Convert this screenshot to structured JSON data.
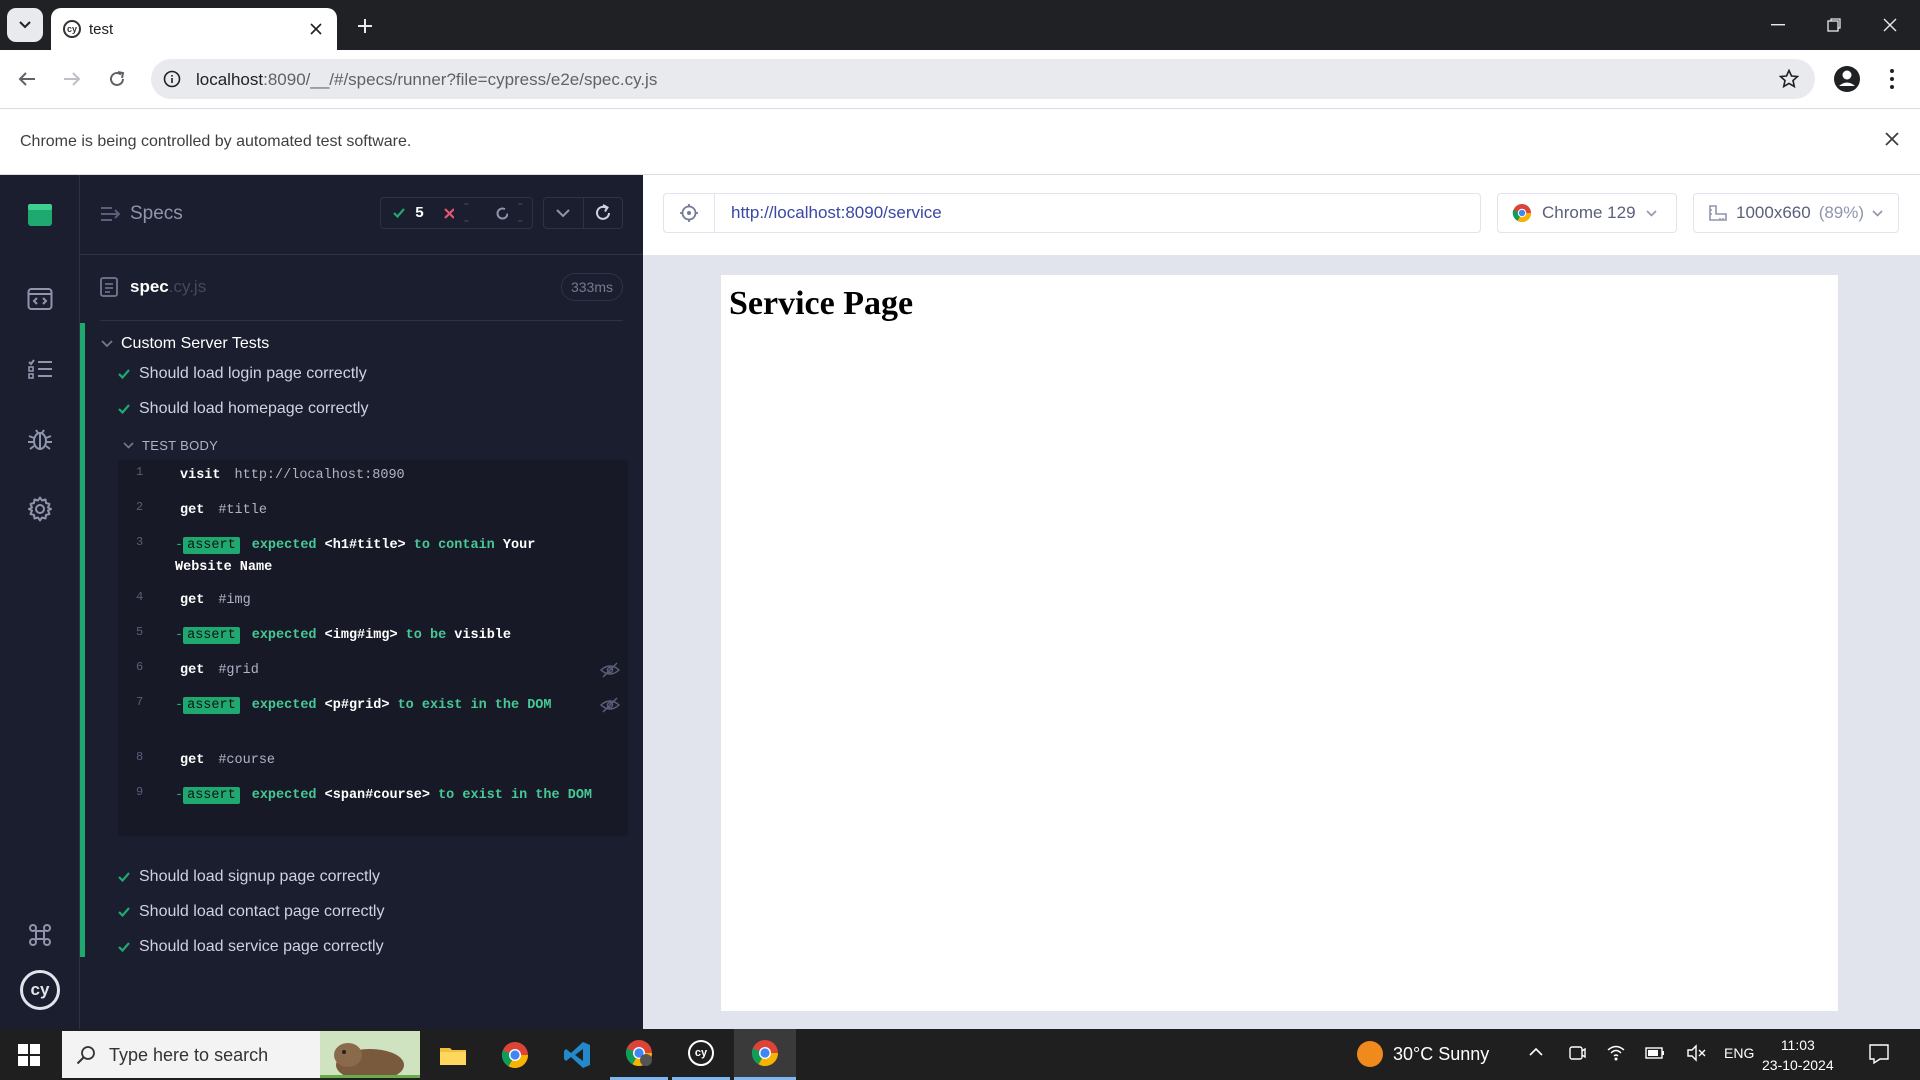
{
  "browser": {
    "tab_title": "test",
    "url_host": "localhost",
    "url_rest": ":8090/__/#/specs/runner?file=cypress/e2e/spec.cy.js",
    "infobar_text": "Chrome is being controlled by automated test software."
  },
  "reporter": {
    "specs_label": "Specs",
    "passed_count": "5",
    "failed_count": "--",
    "pending_count": "--",
    "spec_name": "spec",
    "spec_ext": ".cy.js",
    "spec_duration": "333ms",
    "suite_title": "Custom Server Tests",
    "tests_before": [
      {
        "title": "Should load login page correctly",
        "state": "passed"
      },
      {
        "title": "Should load homepage correctly",
        "state": "passed"
      }
    ],
    "test_body_label": "TEST BODY",
    "commands": [
      {
        "num": "1",
        "name": "visit",
        "message": "http://localhost:8090"
      },
      {
        "num": "2",
        "name": "get",
        "message": "#title"
      },
      {
        "num": "3",
        "name": "assert",
        "parts": [
          "expected",
          "<h1#title>",
          "to contain",
          "Your Website Name"
        ]
      },
      {
        "num": "4",
        "name": "get",
        "message": "#img"
      },
      {
        "num": "5",
        "name": "assert",
        "parts": [
          "expected",
          "<img#img>",
          "to be",
          "visible"
        ]
      },
      {
        "num": "6",
        "name": "get",
        "message": "#grid",
        "hidden": true
      },
      {
        "num": "7",
        "name": "assert",
        "parts": [
          "expected",
          "<p#grid>",
          "to exist in the",
          "DOM"
        ],
        "hidden": true
      },
      {
        "num": "8",
        "name": "get",
        "message": "#course"
      },
      {
        "num": "9",
        "name": "assert",
        "parts": [
          "expected",
          "<span#course>",
          "to exist in the",
          "DOM"
        ]
      }
    ],
    "tests_after": [
      {
        "title": "Should load signup page correctly",
        "state": "passed"
      },
      {
        "title": "Should load contact page correctly",
        "state": "passed"
      },
      {
        "title": "Should load service page correctly",
        "state": "passed"
      }
    ]
  },
  "aut": {
    "url": "http://localhost:8090/service",
    "browser_label": "Chrome 129",
    "viewport_label": "1000x660",
    "viewport_scale": "(89%)",
    "page_heading": "Service Page"
  },
  "taskbar": {
    "search_placeholder": "Type here to search",
    "weather": "30°C  Sunny",
    "lang": "ENG",
    "time": "11:03",
    "date": "23-10-2024"
  },
  "colors": {
    "cypress_bg": "#1b1e2e",
    "pass_green": "#1fa971",
    "fail_red": "#e45770",
    "aut_url_blue": "#3a47a4"
  }
}
